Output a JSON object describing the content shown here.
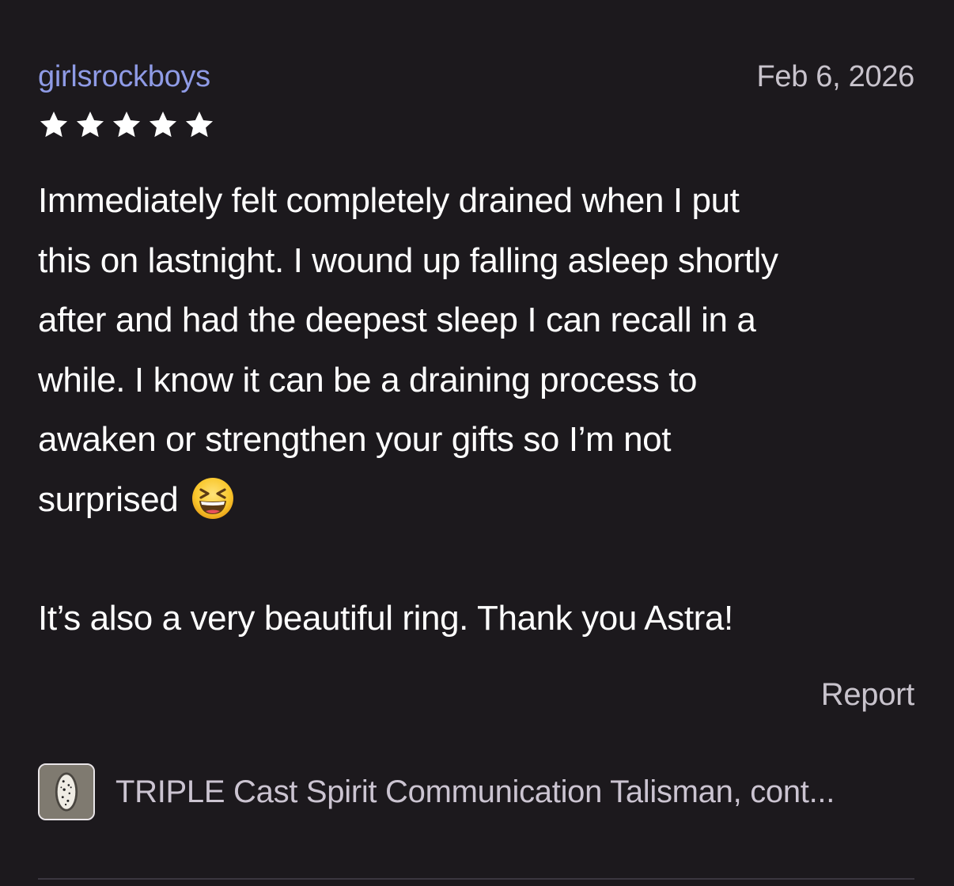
{
  "review": {
    "username": "girlsrockboys",
    "date": "Feb 6, 2026",
    "rating": 5,
    "rating_max": 5,
    "body_lines": [
      "Immediately felt completely drained when I put",
      "this on lastnight. I wound up falling asleep shortly",
      "after and had the deepest sleep I can recall in a",
      "while. I know it can be a draining process to",
      "awaken or strengthen your gifts so I’m not",
      "surprised"
    ],
    "body_emoji": "grinning-squinting-face-emoji",
    "body_paragraph_2": "It’s also a very beautiful ring. Thank you Astra!",
    "report_label": "Report"
  },
  "product": {
    "title": "TRIPLE Cast Spirit Communication Talisman, cont...",
    "thumb_icon": "ring-thumbnail"
  },
  "colors": {
    "background": "#1c191d",
    "username": "#8f9be6",
    "muted_text": "#c8c3cc",
    "star": "#ffffff"
  }
}
